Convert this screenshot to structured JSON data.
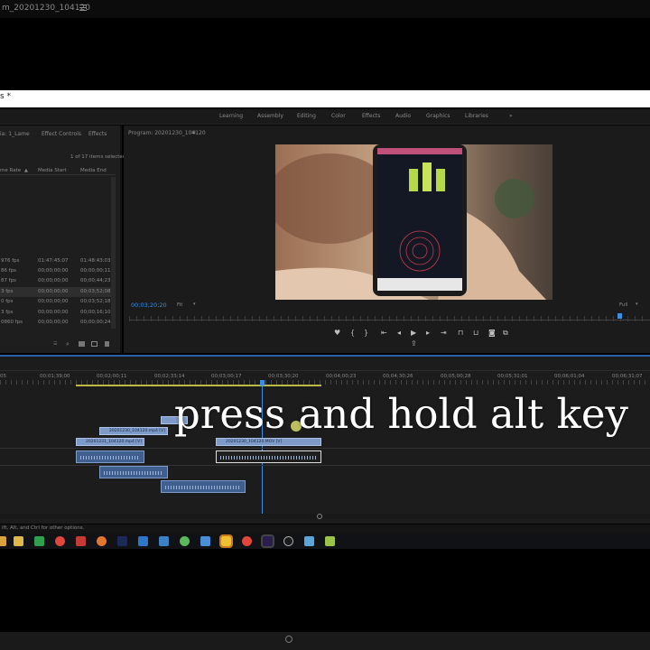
{
  "title_bar": {
    "title": "m_20201230_104120"
  },
  "white_bar": {
    "text": "s *"
  },
  "workspaces": [
    "Learning",
    "Assembly",
    "Editing",
    "Color",
    "Effects",
    "Audio",
    "Graphics",
    "Libraries",
    "»"
  ],
  "project_panel": {
    "tabs": [
      "ia: 1_Lame",
      "Effect Controls",
      "Effects"
    ],
    "items_selected": "1 of 17 items selected",
    "columns": [
      "me Rate",
      "Media Start",
      "Media End"
    ],
    "rows": [
      [
        "976 fps",
        "01:47:45:07",
        "01:48:43:03"
      ],
      [
        "86 fps",
        "00;00;00;00",
        "00;00;00;11"
      ],
      [
        "87 fps",
        "00;00;00;00",
        "00;00;44;23"
      ],
      [
        "3 fps",
        "00;00;00;00",
        "00;03;52;08"
      ],
      [
        "0 fps",
        "00;00;00;00",
        "00;03;52;18"
      ],
      [
        "3 fps",
        "00;00;00;00",
        "00;00;16;10"
      ],
      [
        "0860 fps",
        "00;00;00;00",
        "00;00;00;24"
      ]
    ]
  },
  "program_monitor": {
    "title": "Program: 20201230_104120",
    "timecode": "00;03;20;20",
    "fit": "Fit",
    "quality": "Full"
  },
  "timeline": {
    "ruler": [
      "05",
      "00;01;39;00",
      "00;02;00;11",
      "00;02;33;14",
      "00;03;00;17",
      "00;03;30;20",
      "00;04;00;23",
      "00;04;30;26",
      "00;05;00;28",
      "00;05;31;01",
      "00;06;01;04",
      "00;06;31;07"
    ],
    "clips": [
      "20201230_104120.mp4 [V]",
      "20201231_104120.mp4 [V]",
      "20201230_104120.MOV [V]"
    ]
  },
  "caption": "press and hold alt key",
  "status_text": "ift, Alt, and Ctrl for other options.",
  "colors": {
    "accent": "#2f5ea8",
    "clip": "#7d9ac9",
    "playhead": "#3a8ee6"
  }
}
